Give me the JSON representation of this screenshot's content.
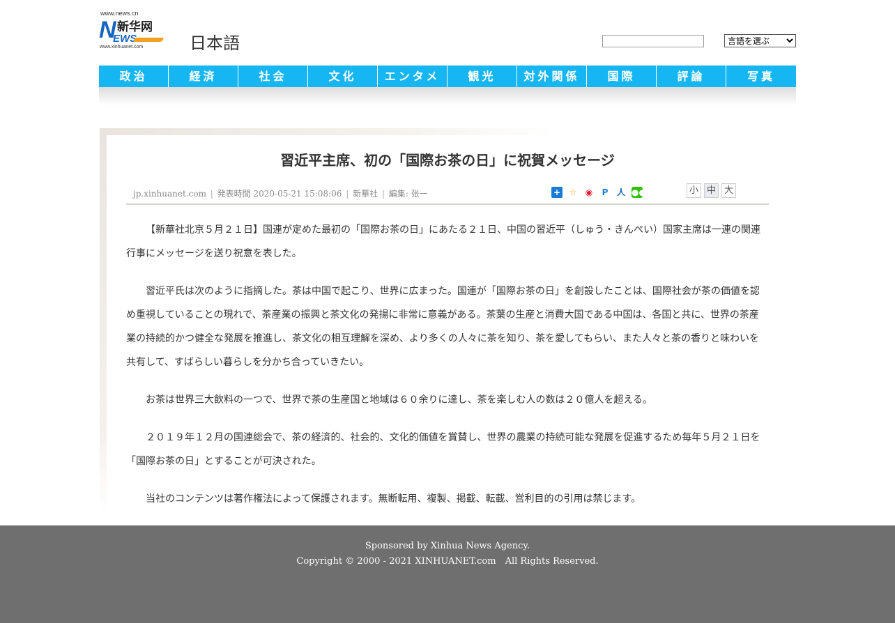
{
  "header": {
    "logo": {
      "url_top": "www.news.cn",
      "mark_n": "N",
      "mark_ews": "EWS",
      "mark_cn": "新华网",
      "url_bottom": "www.xinhuanet.com"
    },
    "language_title": "日本語",
    "search": {
      "value": "",
      "placeholder": ""
    },
    "language_select": {
      "selected": "言語を選ぶ"
    }
  },
  "nav": {
    "items": [
      "政治",
      "経済",
      "社会",
      "文化",
      "エンタメ",
      "観光",
      "対外関係",
      "国際",
      "評論",
      "写真"
    ]
  },
  "article": {
    "title": "習近平主席、初の「国際お茶の日」に祝賀メッセージ",
    "meta": {
      "source_site": "jp.xinhuanet.com",
      "published": "発表時間 2020-05-21 15:08:06",
      "agency": "新華社",
      "editor": "編集: 张一",
      "separator": "|"
    },
    "share_icons": [
      "plus-share",
      "favorite",
      "weibo",
      "p-share",
      "renren",
      "wechat"
    ],
    "font_sizes": [
      "小",
      "中",
      "大"
    ],
    "font_size_active": "中",
    "paragraphs": [
      "【新華社北京５月２１日】国連が定めた最初の「国際お茶の日」にあたる２１日、中国の習近平（しゅう・きんぺい）国家主席は一連の関連行事にメッセージを送り祝意を表した。",
      "習近平氏は次のように指摘した。茶は中国で起こり、世界に広まった。国連が「国際お茶の日」を創設したことは、国際社会が茶の価値を認め重視していることの現れで、茶産業の振興と茶文化の発揚に非常に意義がある。茶葉の生産と消費大国である中国は、各国と共に、世界の茶産業の持続的かつ健全な発展を推進し、茶文化の相互理解を深め、より多くの人々に茶を知り、茶を愛してもらい、また人々と茶の香りと味わいを共有して、すばらしい暮らしを分かち合っていきたい。",
      "お茶は世界三大飲料の一つで、世界で茶の生産国と地域は６０余りに達し、茶を楽しむ人の数は２０億人を超える。",
      "２０１９年１２月の国連総会で、茶の経済的、社会的、文化的価値を賞賛し、世界の農業の持続可能な発展を促進するため毎年５月２１日を「国際お茶の日」とすることが可決された。",
      "当社のコンテンツは著作権法によって保護されます。無断転用、複製、掲載、転載、営利目的の引用は禁じます。"
    ]
  },
  "footer": {
    "line1": "Sponsored by Xinhua News Agency.",
    "line2": "Copyright © 2000 - 2021 XINHUANET.com　All Rights Reserved."
  },
  "colors": {
    "nav_bg": "#16b6f3",
    "footer_bg": "#6f6f6f",
    "logo_blue": "#1565c0",
    "logo_orange": "#f0a020"
  }
}
